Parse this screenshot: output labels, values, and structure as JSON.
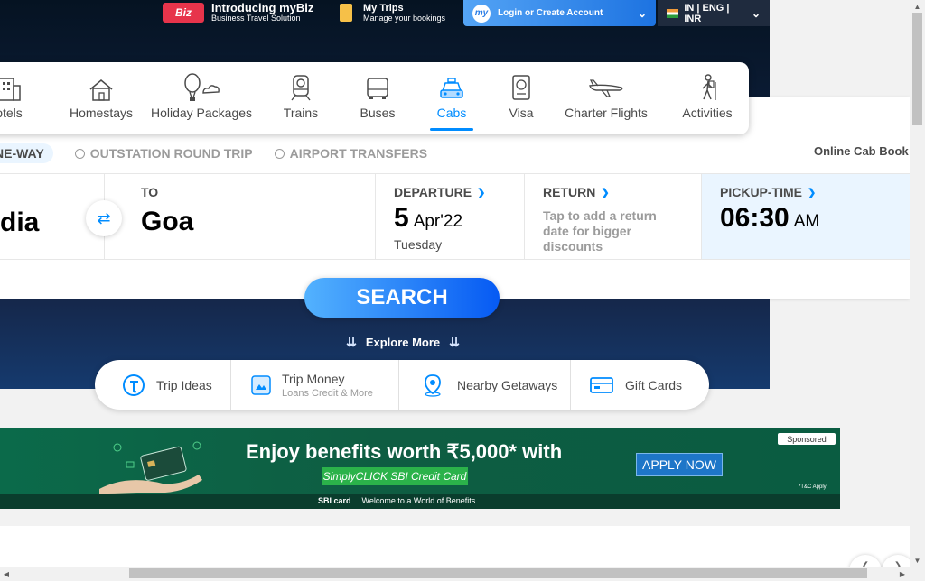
{
  "header": {
    "biz_badge": "Biz",
    "biz_title": "Introducing myBiz",
    "biz_subtitle": "Business Travel Solution",
    "trips_title": "My Trips",
    "trips_subtitle": "Manage your bookings",
    "login_avatar": "my",
    "login_label": "Login or Create Account",
    "language_label": "IN | ENG | INR"
  },
  "nav": {
    "items": [
      {
        "label": "otels",
        "icon": "hotel-icon"
      },
      {
        "label": "Homestays",
        "icon": "home-icon"
      },
      {
        "label": "Holiday Packages",
        "icon": "balloon-icon"
      },
      {
        "label": "Trains",
        "icon": "train-icon"
      },
      {
        "label": "Buses",
        "icon": "bus-icon"
      },
      {
        "label": "Cabs",
        "icon": "cab-icon"
      },
      {
        "label": "Visa",
        "icon": "passport-icon"
      },
      {
        "label": "Charter Flights",
        "icon": "plane-icon"
      },
      {
        "label": "Activities",
        "icon": "hiker-icon"
      }
    ],
    "active": "Cabs"
  },
  "trip_types": [
    "NE-WAY",
    "OUTSTATION ROUND TRIP",
    "AIRPORT TRANSFERS"
  ],
  "online_cab": "Online Cab Book",
  "search": {
    "from_value": "dia",
    "to_label": "TO",
    "to_value": "Goa",
    "departure_label": "DEPARTURE",
    "departure_day": "5",
    "departure_month": "Apr'22",
    "departure_weekday": "Tuesday",
    "return_label": "RETURN",
    "return_hint": "Tap to add a return date for bigger discounts",
    "pickup_label": "PICKUP-TIME",
    "pickup_time": "06:30",
    "pickup_ampm": "AM",
    "swap_symbol": "⇄",
    "search_button": "SEARCH"
  },
  "explore_more": "Explore More",
  "quick_links": [
    {
      "label": "Trip Ideas",
      "sub": "",
      "icon": "trip-ideas-icon"
    },
    {
      "label": "Trip Money",
      "sub": "Loans Credit & More",
      "icon": "trip-money-icon"
    },
    {
      "label": "Nearby Getaways",
      "sub": "",
      "icon": "location-pin-icon"
    },
    {
      "label": "Gift Cards",
      "sub": "",
      "icon": "gift-card-icon"
    }
  ],
  "banner": {
    "headline": "Enjoy benefits worth ₹5,000* with",
    "card_name": "SimplyCLICK SBI Credit Card",
    "apply": "APPLY NOW",
    "sponsored": "Sponsored",
    "sbi_brand": "SBI card",
    "tagline": "Welcome to a World of Benefits",
    "tc": "*T&C Apply"
  },
  "colors": {
    "accent": "#008cff",
    "header_bg": "#0b1b33",
    "banner_green": "#0b6a4a"
  }
}
